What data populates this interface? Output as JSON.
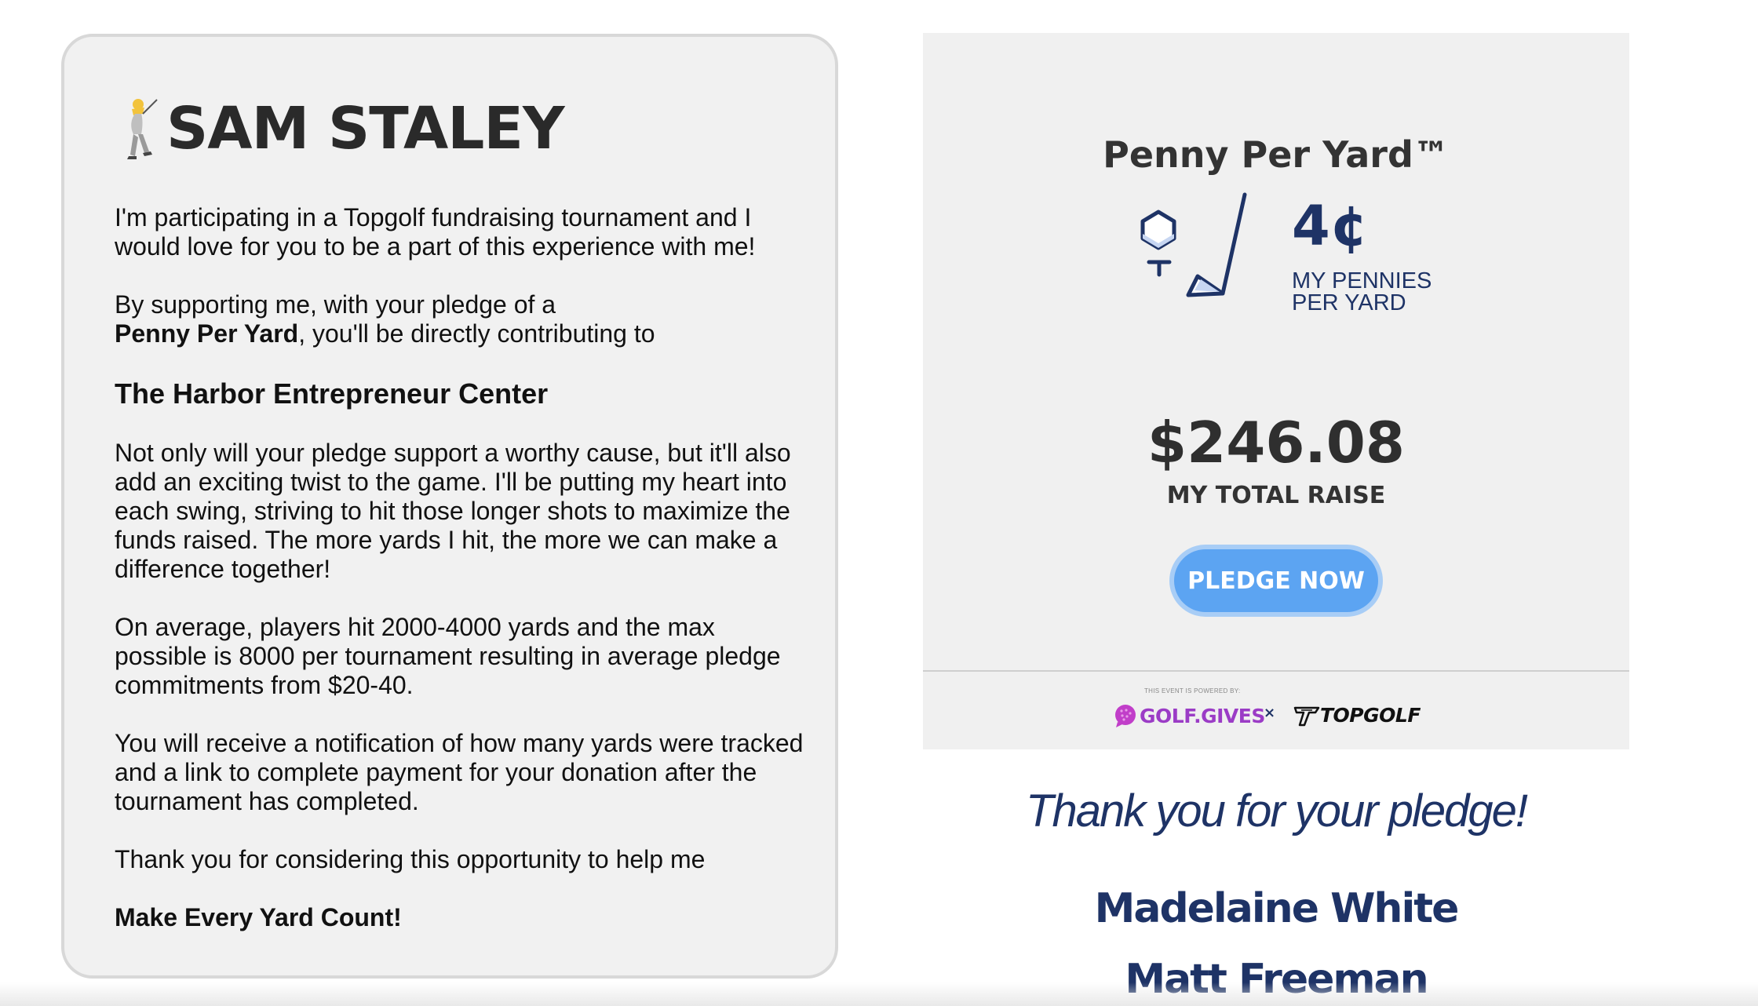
{
  "profile": {
    "name": "SAM STALEY",
    "icon": "golfer-icon"
  },
  "message": {
    "intro": "I'm participating in a Topgolf fundraising tournament and I would love for you to be a part of this experience with me!",
    "support_prefix": "By supporting me, with your pledge of a",
    "support_bold": "Penny Per Yard",
    "support_suffix": ", you'll be directly contributing to",
    "organization": "The Harbor Entrepreneur Center",
    "paragraph_twist": "Not only will your pledge support a worthy cause, but it'll also add an exciting twist to the game. I'll be putting my heart into each swing, striving to hit those longer shots to maximize the funds raised. The more yards I hit, the more we can make a difference together!",
    "paragraph_average": "On average, players hit 2000-4000 yards and the max possible is 8000 per tournament resulting in average pledge commitments from $20-40.",
    "paragraph_notification": "You will receive a notification of how many yards were tracked and a link to complete payment for your donation after the tournament has completed.",
    "paragraph_thanks": "Thank you for considering this opportunity to help me",
    "closing": "Make Every Yard Count!"
  },
  "pledge_panel": {
    "title": "Penny Per Yard™",
    "cents_value": "4¢",
    "cents_label": "MY PENNIES PER YARD",
    "total_amount": "$246.08",
    "total_label": "MY TOTAL RAISE",
    "button_label": "PLEDGE NOW",
    "powered_by": "THIS EVENT IS POWERED BY:",
    "brand_golfgives": "GOLF.GIVES",
    "brand_separator": "×",
    "brand_topgolf": "TOPGOLF"
  },
  "supporters": {
    "heading": "Thank you for your pledge!",
    "names": [
      "Madelaine White",
      "Matt Freeman"
    ]
  },
  "colors": {
    "navy": "#1e3366",
    "button_blue": "#5ca4f2",
    "golfgives_purple": "#9b3cc6",
    "card_bg": "#f1f1f1"
  }
}
